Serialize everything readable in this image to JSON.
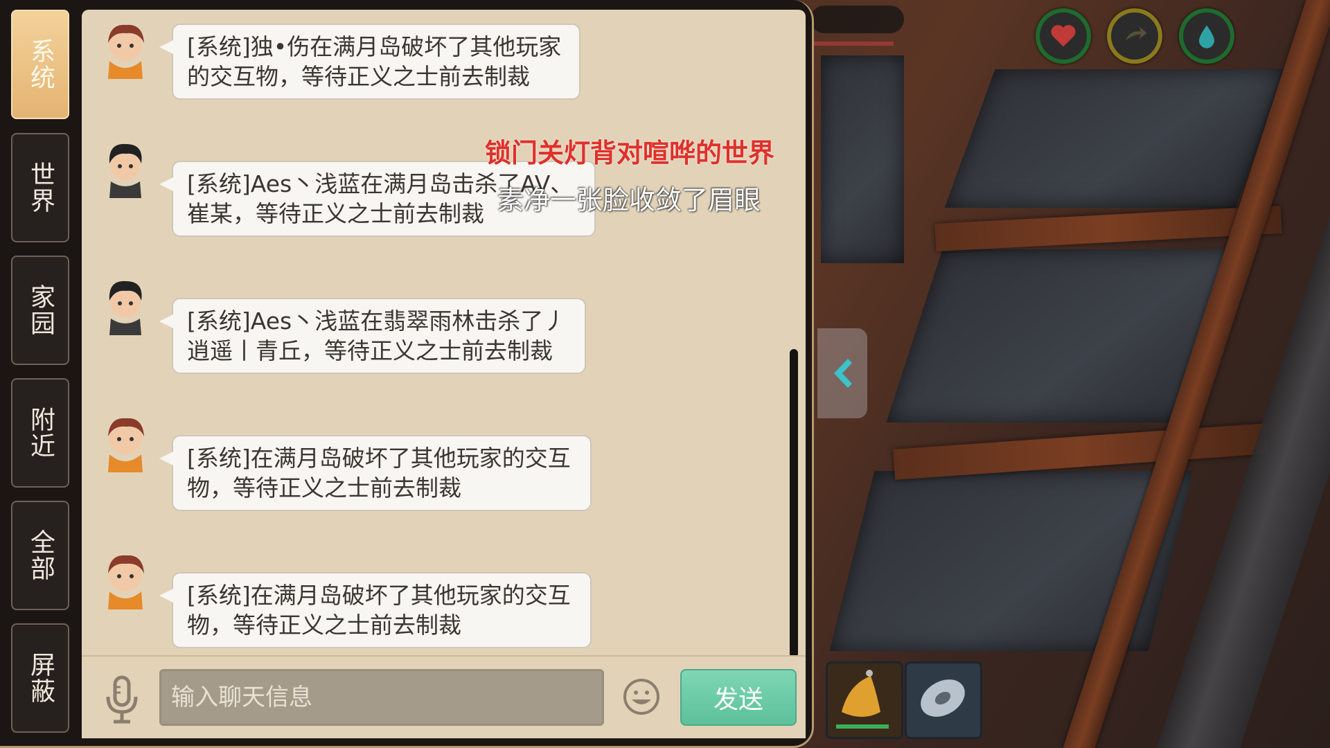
{
  "channels": [
    {
      "label": "系统",
      "active": true
    },
    {
      "label": "世界",
      "active": false
    },
    {
      "label": "家园",
      "active": false
    },
    {
      "label": "附近",
      "active": false
    },
    {
      "label": "全部",
      "active": false
    },
    {
      "label": "屏蔽",
      "active": false
    }
  ],
  "messages": [
    {
      "avatar": "girl-avatar",
      "lines": [
        "[系统]独•伤在满月岛破坏了其他玩家",
        "的交互物，等待正义之士前去制裁"
      ]
    },
    {
      "avatar": "boy-avatar",
      "lines": [
        "[系统]Aes丶浅蓝在满月岛击杀了AV、",
        "崔某，等待正义之士前去制裁"
      ]
    },
    {
      "avatar": "boy-avatar",
      "lines": [
        "[系统]Aes丶浅蓝在翡翠雨林击杀了丿",
        "逍遥丨青丘，等待正义之士前去制裁"
      ]
    },
    {
      "avatar": "girl-avatar",
      "lines": [
        "[系统]在满月岛破坏了其他玩家的交互",
        "物，等待正义之士前去制裁"
      ]
    },
    {
      "avatar": "girl-avatar",
      "lines": [
        "[系统]在满月岛破坏了其他玩家的交互",
        "物，等待正义之士前去制裁"
      ]
    }
  ],
  "overlay": {
    "red_text": "锁门关灯背对喧哗的世界",
    "white_text": "素净一张脸收敛了眉眼"
  },
  "input": {
    "placeholder": "输入聊天信息",
    "send_label": "发送"
  },
  "hud": {
    "icons": [
      "heart-icon",
      "stamina-icon",
      "water-drop-icon"
    ],
    "ring_color": "#1e6b2e"
  },
  "colors": {
    "active_tab": "#e4b373",
    "send_button": "#5cc19b",
    "chat_bg": "#e2d3b8"
  }
}
